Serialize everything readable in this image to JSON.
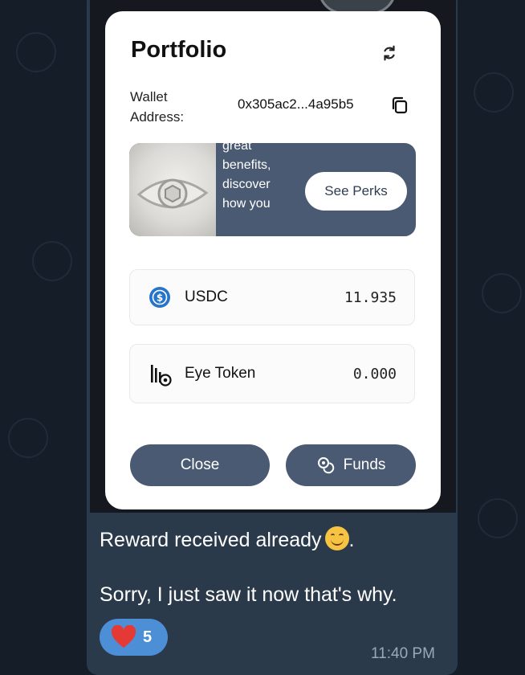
{
  "portfolio": {
    "title": "Portfolio",
    "wallet_label": "Wallet\nAddress:",
    "wallet_address": "0x305ac2...4a95b5"
  },
  "banner": {
    "text": "great\nbenefits,\ndiscover\nhow you",
    "button_label": "See Perks"
  },
  "tokens": [
    {
      "name": "USDC",
      "amount": "11.935",
      "icon": "usdc-coin-icon"
    },
    {
      "name": "Eye Token",
      "amount": "0.000",
      "icon": "eye-token-icon"
    }
  ],
  "actions": {
    "close_label": "Close",
    "funds_label": "Funds"
  },
  "message": {
    "line1": "Reward received already",
    "line1_suffix": ".",
    "line2": "Sorry, I just saw it now that's why.",
    "reaction_count": "5",
    "reaction_icon": "heart-icon",
    "time": "11:40 PM"
  },
  "colors": {
    "accent": "#4a5a72",
    "bubble": "#2b3a4b",
    "reaction": "#4d8fd6",
    "usdc": "#2775ca"
  }
}
